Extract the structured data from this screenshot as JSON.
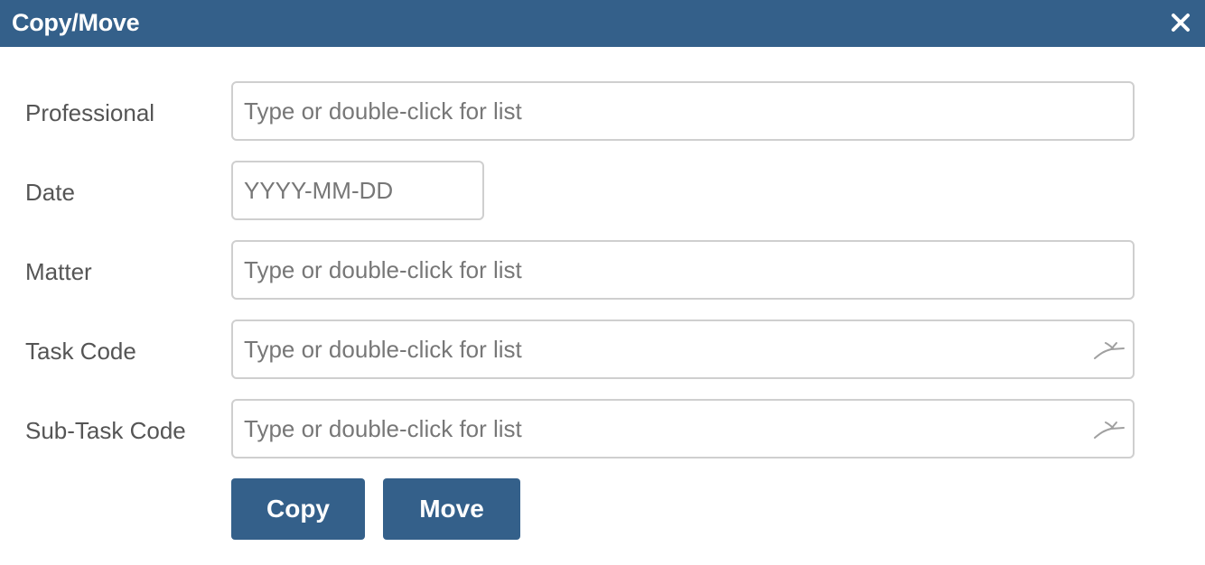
{
  "dialog": {
    "title": "Copy/Move",
    "close_icon": "close-icon",
    "accent_color": "#34608a"
  },
  "form": {
    "professional": {
      "label": "Professional",
      "value": "",
      "placeholder": "Type or double-click for list"
    },
    "date": {
      "label": "Date",
      "value": "",
      "placeholder": "YYYY-MM-DD"
    },
    "matter": {
      "label": "Matter",
      "value": "",
      "placeholder": "Type or double-click for list"
    },
    "task_code": {
      "label": "Task Code",
      "value": "",
      "placeholder": "Type or double-click for list",
      "icon": "lookup-arrow-icon"
    },
    "sub_task_code": {
      "label": "Sub-Task Code",
      "value": "",
      "placeholder": "Type or double-click for list",
      "icon": "lookup-arrow-icon"
    }
  },
  "actions": {
    "copy_label": "Copy",
    "move_label": "Move"
  }
}
